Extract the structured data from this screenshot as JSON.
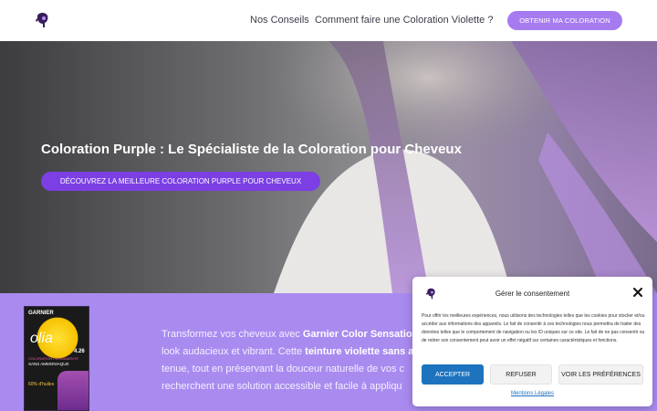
{
  "header": {
    "nav": [
      "Nos Conseils",
      "Comment faire une Coloration Violette ?"
    ],
    "cta_label": "OBTENIR MA COLORATION"
  },
  "hero": {
    "title": "Coloration Purple : Le Spécialiste de la Coloration pour Cheveux",
    "button_label": "DÉCOUVREZ LA MEILLEURE COLORATION PURPLE POUR CHEVEUX"
  },
  "product": {
    "brand": "GARNIER",
    "name": "olia",
    "sub1": "COLORATION PERMANENTE",
    "sub2": "SANS AMMONIAQUE",
    "shade": "4.26",
    "pct": "60% d'huiles"
  },
  "section": {
    "t1": "Transformez vos cheveux avec ",
    "b1": "Garnier Color Sensation",
    "t2": "look audacieux et vibrant. Cette ",
    "b2": "teinture violette sans a",
    "t3": "tenue, tout en préservant la douceur naturelle de vos c",
    "t4": "recherchent une solution accessible et facile à appliqu"
  },
  "consent": {
    "title": "Gérer le consentement",
    "body": "Pour offrir les meilleures expériences, nous utilisons des technologies telles que les cookies pour stocker et/ou accéder aux informations des appareils. Le fait de consentir à ces technologies nous permettra de traiter des données telles que le comportement de navigation ou les ID uniques sur ce site. Le fait de ne pas consentir ou de retirer son consentement peut avoir un effet négatif sur certaines caractéristiques et fonctions.",
    "accept_label": "ACCEPTER",
    "refuse_label": "REFUSER",
    "prefs_label": "VOIR LES PRÉFÉRENCES",
    "legal_link": "Mentions Légales"
  },
  "colors": {
    "accent": "#a77bf0",
    "hero_button": "#7b3fe4",
    "section_bg": "#a98bf0",
    "consent_accept": "#1e73be"
  },
  "icons": [
    "site-logo-icon",
    "close-icon"
  ]
}
